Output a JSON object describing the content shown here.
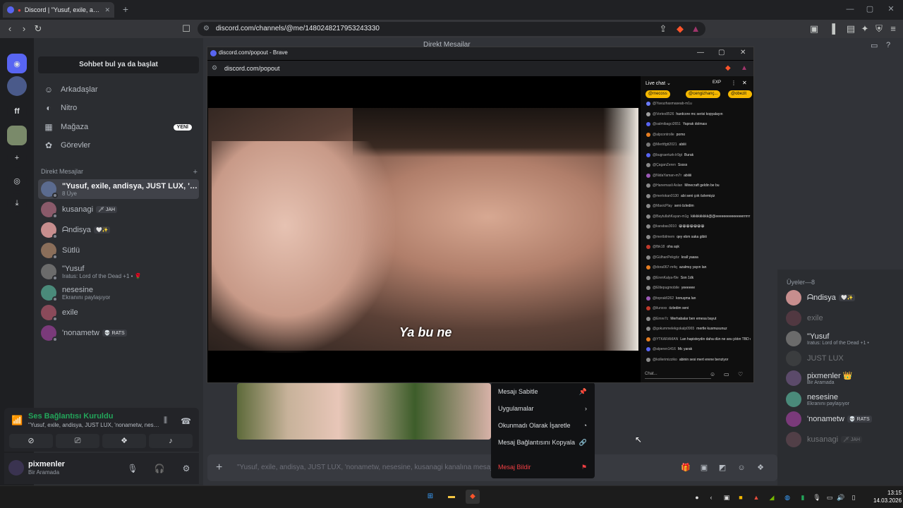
{
  "browser": {
    "tab_title": "Discord | \"Yusuf, exile, andisya, JUST LUX, 'nonametw, nesesine, kusanagi\"",
    "url": "discord.com/channels/@me/1480248217953243330"
  },
  "popout": {
    "title": "discord.com/popout - Brave",
    "url": "discord.com/popout",
    "subtitle": "Ya bu ne"
  },
  "livechat": {
    "header": "Live chat",
    "exp_badge": "EXP",
    "pills": [
      "@mecoss",
      "@cengizhanç...",
      "@obezit"
    ],
    "messages": [
      {
        "user": "@Yavuzhasmaseab-m1u",
        "text": "",
        "color": "#6b7cff"
      },
      {
        "user": "@Vortex8526",
        "text": "hardcore mc serisi kopyalayın",
        "color": "#a0a0a0"
      },
      {
        "user": "@salmibagci2651",
        "text": "Yaprak dolması",
        "color": "#5865f2"
      },
      {
        "user": "@alpcontrolle",
        "text": "pomo",
        "color": "#e67e22"
      },
      {
        "user": "@Merttfgtt2021",
        "text": "abiiii",
        "color": "#7a7a7a"
      },
      {
        "user": "@bugraerturk-lr9gt",
        "text": "Burak",
        "color": "#5865f2"
      },
      {
        "user": "@ÇaganZeren",
        "text": "Sssss",
        "color": "#8a8a8a"
      },
      {
        "user": "@NidaYaman-m7r",
        "text": "abiiiii",
        "color": "#9b59b6"
      },
      {
        "user": "@Hanemasli Aslan",
        "text": "Minecraft geldin be bu",
        "color": "#8a8a8a"
      },
      {
        "user": "@mertokan0130",
        "text": "abi seni çok özlemişiz",
        "color": "#8a8a8a"
      },
      {
        "user": "@MavicPlay",
        "text": "seni özledim",
        "color": "#8a8a8a"
      },
      {
        "user": "@BaytullahKayan-m1g",
        "text": "kkkkkkkkkk@@eeeeeeeeeeeeeerrrrrr",
        "color": "#8a8a8a"
      },
      {
        "user": "@karabas3010",
        "text": "😀😀😀😀😀😀😀",
        "color": "#8a8a8a"
      },
      {
        "user": "@mertbilmem",
        "text": "qey ebm saka gibiii",
        "color": "#8a8a8a"
      },
      {
        "user": "@fbk18",
        "text": "oha aşk",
        "color": "#c0392b"
      },
      {
        "user": "@GülhanPekgöz",
        "text": "krall yaasa",
        "color": "#8a8a8a"
      },
      {
        "user": "@dora067-m4q",
        "text": "azalmış yayın lan",
        "color": "#e67e22"
      },
      {
        "user": "@ErenKalya-f9e",
        "text": "Son 1dk",
        "color": "#8a8a8a"
      },
      {
        "user": "@Elitepugmobile",
        "text": "yeeeeee",
        "color": "#8a8a8a"
      },
      {
        "user": "@toprak6262",
        "text": "konuşma lan",
        "color": "#9b59b6"
      },
      {
        "user": "@ilunxxx",
        "text": "özledim seni",
        "color": "#c0392b"
      },
      {
        "user": "@Emre7c",
        "text": "Merhabalar ben emesa bayut",
        "color": "#8a8a8a"
      },
      {
        "user": "@gokummelekgokalp0965",
        "text": "mertle kusmusunuz",
        "color": "#8a8a8a"
      },
      {
        "user": "@YTKARAMAN",
        "text": "Lan hapisteydin daha dün ne ara çıktın TBD deki şerif gibi girip çıkıyon",
        "color": "#e67e22"
      },
      {
        "user": "@alperen1416",
        "text": "Mc yarak",
        "color": "#5865f2"
      },
      {
        "user": "@kollerimizziko",
        "text": "abinin sesi mert erene benziyor",
        "color": "#8a8a8a"
      }
    ],
    "input_placeholder": "Chat..."
  },
  "discord": {
    "dm_title": "Direkt Mesajlar",
    "search_label": "Sohbet bul ya da başlat",
    "nav": [
      {
        "label": "Arkadaşlar",
        "icon": "friends-icon"
      },
      {
        "label": "Nitro",
        "icon": "nitro-icon"
      },
      {
        "label": "Mağaza",
        "icon": "shop-icon",
        "badge": "YENİ"
      },
      {
        "label": "Görevler",
        "icon": "quests-icon"
      }
    ],
    "dm_header": "Direkt Mesajlar",
    "dms": [
      {
        "name": "\"Yusuf, exile, andisya, JUST LUX, 'nona...",
        "sub": "8 Üye",
        "active": true,
        "color": "#5b6b8f"
      },
      {
        "name": "kusanagi",
        "tag": "🗡 JAH",
        "sub": "",
        "color": "#8a5a6a"
      },
      {
        "name": "ᗩndisya",
        "tag": "🤍✨",
        "sub": "",
        "color": "#c78e8e"
      },
      {
        "name": "Sütlü",
        "sub": "",
        "color": "#8a6e5a"
      },
      {
        "name": "\"Yusuf",
        "sub": "Iratus: Lord of the Dead +1 • 🌹",
        "color": "#6b6b6b"
      },
      {
        "name": "nesesine",
        "sub": "Ekranını paylaşıyor",
        "color": "#4a8a7a"
      },
      {
        "name": "exile",
        "sub": "",
        "color": "#8a4a5a"
      },
      {
        "name": "'nonametw",
        "tag": "💀 RATS",
        "sub": "",
        "color": "#7a3a7a"
      }
    ],
    "voice": {
      "title": "Ses Bağlantısı Kuruldu",
      "sub": "\"Yusuf, exile, andisya, JUST LUX, 'nonametw, nesesine, kusanagi\""
    },
    "user": {
      "name": "pixmenler",
      "status": "Bir Aramada"
    },
    "message_placeholder": "\"Yusuf, exile, andisya, JUST LUX, 'nonametw, nesesine, kusanagi kanalına mesaj gönder",
    "context_menu": [
      {
        "label": "Mesajı Sabitle",
        "icon": "pin-icon"
      },
      {
        "label": "Uygulamalar",
        "icon": "chevron-right-icon"
      },
      {
        "label": "Okunmadı Olarak İşaretle",
        "icon": "unread-icon"
      },
      {
        "label": "Mesaj Bağlantısını Kopyala",
        "icon": "link-icon"
      },
      {
        "label": "Mesaj Bildir",
        "icon": "flag-icon",
        "danger": true
      }
    ],
    "members_header": "Üyeler—8",
    "members": [
      {
        "name": "ᗩndisya",
        "tag": "🤍✨",
        "sub": "",
        "dim": false,
        "color": "#c78e8e"
      },
      {
        "name": "exile",
        "sub": "",
        "dim": true,
        "color": "#8a4a5a"
      },
      {
        "name": "\"Yusuf",
        "sub": "Iratus: Lord of the Dead +1 •",
        "dim": false,
        "color": "#6b6b6b"
      },
      {
        "name": "JUST LUX",
        "sub": "",
        "dim": true,
        "color": "#555"
      },
      {
        "name": "pixmenler 👑",
        "sub": "Bir Aramada",
        "dim": false,
        "color": "#5b4a6a"
      },
      {
        "name": "nesesine",
        "sub": "Ekranını paylaşıyor",
        "dim": false,
        "color": "#4a8a7a"
      },
      {
        "name": "'nonametw",
        "tag": "💀 RATS",
        "sub": "",
        "dim": false,
        "color": "#7a3a7a"
      },
      {
        "name": "kusanagi",
        "tag": "🗡 JAH",
        "sub": "",
        "dim": true,
        "color": "#8a5a6a"
      }
    ]
  },
  "taskbar": {
    "time": "13:15",
    "date": "14.03.2026"
  }
}
